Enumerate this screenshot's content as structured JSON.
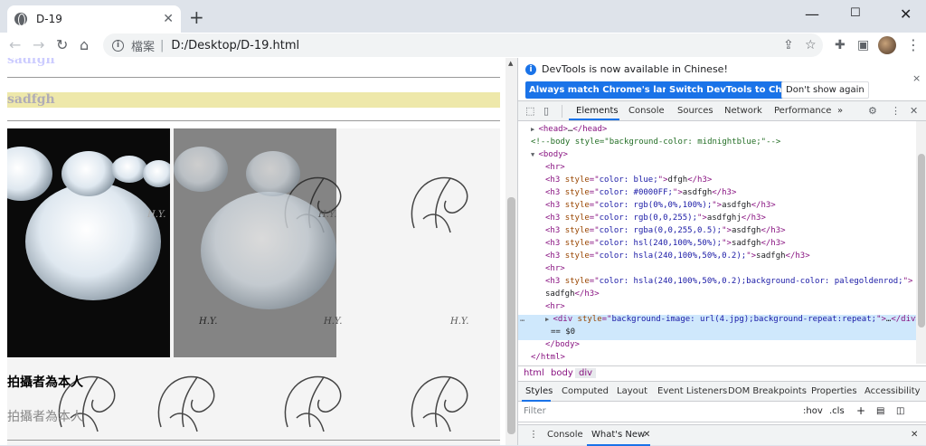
{
  "browser": {
    "tab_title": "D-19",
    "tab_close": "✕",
    "new_tab": "+",
    "minimize": "—",
    "maximize": "☐",
    "close": "✕",
    "back": "←",
    "forward": "→",
    "reload": "↻",
    "home": "⌂",
    "url_label": "檔案",
    "url_separator": "|",
    "url": "D:/Desktop/D-19.html",
    "more": "⋮"
  },
  "page": {
    "cutoff_heading": "sadfgh",
    "gold_heading": "sadfgh",
    "watermark": "H.Y.",
    "caption_bold": "拍攝者為本人",
    "caption_gray": "拍攝者為本人"
  },
  "devtools": {
    "info_message": "DevTools is now available in Chinese!",
    "btn_match": "Always match Chrome's language",
    "btn_switch": "Switch DevTools to Chinese",
    "btn_dismiss": "Don't show again",
    "info_close": "×",
    "tabs": [
      "Elements",
      "Console",
      "Sources",
      "Network",
      "Performance",
      "»"
    ],
    "tree": [
      {
        "indent": 0,
        "tri": "▶",
        "parts": [
          [
            "tag",
            "<head>"
          ],
          [
            "txt",
            "…"
          ],
          [
            "tag",
            "</head>"
          ]
        ]
      },
      {
        "indent": 0,
        "tri": "",
        "parts": [
          [
            "cmt",
            "<!--body style=\"background-color: midnightblue;\"-->"
          ]
        ]
      },
      {
        "indent": 0,
        "tri": "▼",
        "parts": [
          [
            "tag",
            "<body>"
          ]
        ]
      },
      {
        "indent": 1,
        "tri": "",
        "parts": [
          [
            "tag",
            "<hr>"
          ]
        ]
      },
      {
        "indent": 1,
        "tri": "",
        "parts": [
          [
            "tag",
            "<h3 "
          ],
          [
            "attr",
            "style"
          ],
          [
            "tag",
            "=\""
          ],
          [
            "val",
            "color: blue;"
          ],
          [
            "tag",
            "\">"
          ],
          [
            "txt",
            "dfgh"
          ],
          [
            "tag",
            "</h3>"
          ]
        ]
      },
      {
        "indent": 1,
        "tri": "",
        "parts": [
          [
            "tag",
            "<h3 "
          ],
          [
            "attr",
            "style"
          ],
          [
            "tag",
            "=\""
          ],
          [
            "val",
            "color: #0000FF;"
          ],
          [
            "tag",
            "\">"
          ],
          [
            "txt",
            "asdfgh"
          ],
          [
            "tag",
            "</h3>"
          ]
        ]
      },
      {
        "indent": 1,
        "tri": "",
        "parts": [
          [
            "tag",
            "<h3 "
          ],
          [
            "attr",
            "style"
          ],
          [
            "tag",
            "=\""
          ],
          [
            "val",
            "color: rgb(0%,0%,100%);"
          ],
          [
            "tag",
            "\">"
          ],
          [
            "txt",
            "asdfgh"
          ],
          [
            "tag",
            "</h3>"
          ]
        ]
      },
      {
        "indent": 1,
        "tri": "",
        "parts": [
          [
            "tag",
            "<h3 "
          ],
          [
            "attr",
            "style"
          ],
          [
            "tag",
            "=\""
          ],
          [
            "val",
            "color: rgb(0,0,255);"
          ],
          [
            "tag",
            "\">"
          ],
          [
            "txt",
            "asdfghj"
          ],
          [
            "tag",
            "</h3>"
          ]
        ]
      },
      {
        "indent": 1,
        "tri": "",
        "parts": [
          [
            "tag",
            "<h3 "
          ],
          [
            "attr",
            "style"
          ],
          [
            "tag",
            "=\""
          ],
          [
            "val",
            "color: rgba(0,0,255,0.5);"
          ],
          [
            "tag",
            "\">"
          ],
          [
            "txt",
            "asdfgh"
          ],
          [
            "tag",
            "</h3>"
          ]
        ]
      },
      {
        "indent": 1,
        "tri": "",
        "parts": [
          [
            "tag",
            "<h3 "
          ],
          [
            "attr",
            "style"
          ],
          [
            "tag",
            "=\""
          ],
          [
            "val",
            "color: hsl(240,100%,50%);"
          ],
          [
            "tag",
            "\">"
          ],
          [
            "txt",
            "sadfgh"
          ],
          [
            "tag",
            "</h3>"
          ]
        ]
      },
      {
        "indent": 1,
        "tri": "",
        "parts": [
          [
            "tag",
            "<h3 "
          ],
          [
            "attr",
            "style"
          ],
          [
            "tag",
            "=\""
          ],
          [
            "val",
            "color: hsla(240,100%,50%,0.2);"
          ],
          [
            "tag",
            "\">"
          ],
          [
            "txt",
            "sadfgh"
          ],
          [
            "tag",
            "</h3>"
          ]
        ]
      },
      {
        "indent": 1,
        "tri": "",
        "parts": [
          [
            "tag",
            "<hr>"
          ]
        ]
      },
      {
        "indent": 1,
        "tri": "",
        "parts": [
          [
            "tag",
            "<h3 "
          ],
          [
            "attr",
            "style"
          ],
          [
            "tag",
            "=\""
          ],
          [
            "val",
            "color: hsla(240,100%,50%,0.2);background-color: palegoldenrod;"
          ],
          [
            "tag",
            "\">"
          ]
        ]
      },
      {
        "indent": 1,
        "tri": "",
        "parts": [
          [
            "txt",
            "sadfgh"
          ],
          [
            "tag",
            "</h3>"
          ]
        ]
      },
      {
        "indent": 1,
        "tri": "",
        "parts": [
          [
            "tag",
            "<hr>"
          ]
        ]
      },
      {
        "indent": 1,
        "tri": "▶",
        "parts": [
          [
            "tag",
            "<div "
          ],
          [
            "attr",
            "style"
          ],
          [
            "tag",
            "=\""
          ],
          [
            "val",
            "background-image: url(4.jpg);background-repeat:repeat;"
          ],
          [
            "tag",
            "\">"
          ],
          [
            "txt",
            "…"
          ],
          [
            "tag",
            "</div>"
          ]
        ]
      },
      {
        "indent": 2,
        "tri": "",
        "parts": [
          [
            "txt",
            "== $0"
          ]
        ]
      },
      {
        "indent": 1,
        "tri": "",
        "parts": [
          [
            "tag",
            "</body>"
          ]
        ]
      },
      {
        "indent": 0,
        "tri": "",
        "parts": [
          [
            "tag",
            "</html>"
          ]
        ]
      }
    ],
    "selected_dots": "⋯",
    "breadcrumbs": [
      "html",
      "body",
      "div"
    ],
    "style_tabs": [
      "Styles",
      "Computed",
      "Layout",
      "Event Listeners",
      "DOM Breakpoints",
      "Properties",
      "Accessibility"
    ],
    "filter_placeholder": "Filter",
    "hov": ":hov",
    "cls": ".cls",
    "plus": "+",
    "drawer_menu": "⋮",
    "drawer_tabs": [
      "Console",
      "What's New"
    ],
    "drawer_close": "✕",
    "devtools_close": "✕",
    "settings": "⚙",
    "kebab": "⋮"
  }
}
